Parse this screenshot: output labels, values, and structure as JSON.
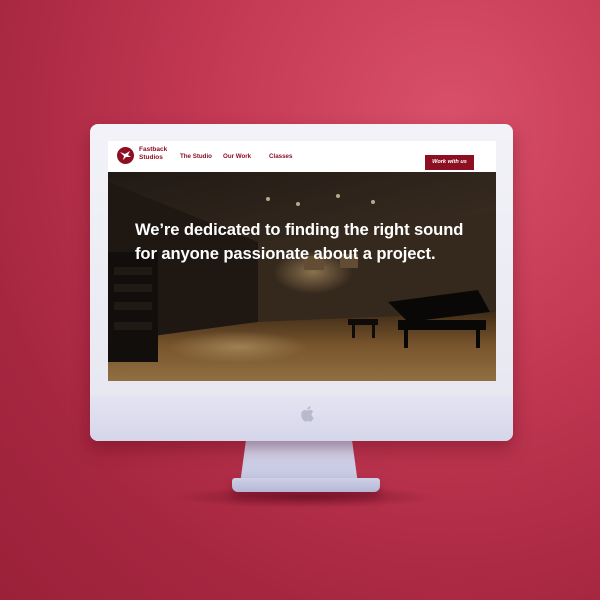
{
  "brand": {
    "name_line1": "Fastback",
    "name_line2": "Studios"
  },
  "nav": {
    "links": [
      {
        "label": "The Studio"
      },
      {
        "label": "Our Work"
      },
      {
        "label": "Classes"
      }
    ],
    "cta_label": "Work with us"
  },
  "hero": {
    "headline": "We’re dedicated to finding the right sound for anyone passionate about a project."
  },
  "colors": {
    "brand": "#8c0f22",
    "background": "#c53a55",
    "headline_text": "#ffffff"
  },
  "icons": {
    "logo": "bird-logo-icon",
    "device_logo": "apple-logo-icon"
  }
}
